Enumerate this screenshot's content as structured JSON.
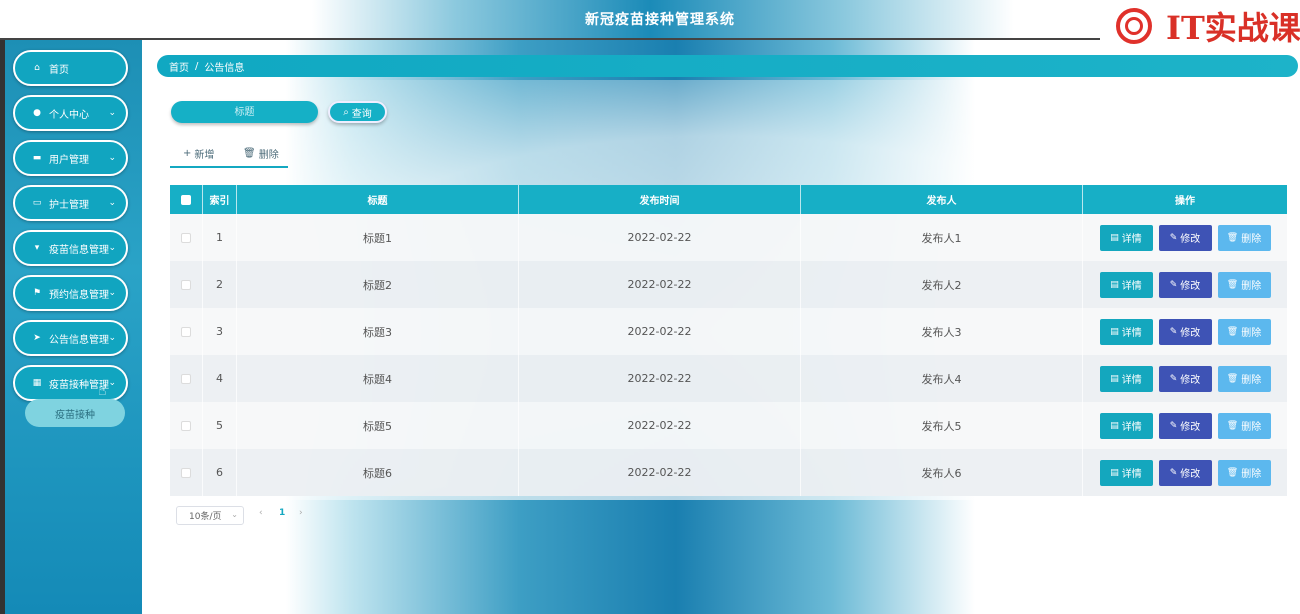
{
  "header": {
    "title": "新冠疫苗接种管理系统",
    "brand_text": "IT实战课"
  },
  "sidebar": {
    "items": [
      {
        "label": "首页",
        "icon": "home-icon",
        "has_children": false
      },
      {
        "label": "个人中心",
        "icon": "user-icon",
        "has_children": true
      },
      {
        "label": "用户管理",
        "icon": "monitor-icon",
        "has_children": true
      },
      {
        "label": "护士管理",
        "icon": "ticket-icon",
        "has_children": true
      },
      {
        "label": "疫苗信息管理",
        "icon": "cup-icon",
        "has_children": true
      },
      {
        "label": "预约信息管理",
        "icon": "flag-icon",
        "has_children": true
      },
      {
        "label": "公告信息管理",
        "icon": "send-icon",
        "has_children": true
      },
      {
        "label": "疫苗接种管理",
        "icon": "grid-icon",
        "has_children": true
      }
    ],
    "submenu": {
      "label": "疫苗接种"
    }
  },
  "breadcrumb": {
    "home": "首页",
    "separator": "/",
    "current": "公告信息"
  },
  "search": {
    "placeholder": "标题",
    "button_label": "查询"
  },
  "toolbar": {
    "add_label": "新增",
    "delete_label": "删除"
  },
  "table": {
    "columns": [
      "索引",
      "标题",
      "发布时间",
      "发布人",
      "操作"
    ],
    "rows": [
      {
        "index": "1",
        "title": "标题1",
        "time": "2022-02-22",
        "publisher": "发布人1"
      },
      {
        "index": "2",
        "title": "标题2",
        "time": "2022-02-22",
        "publisher": "发布人2"
      },
      {
        "index": "3",
        "title": "标题3",
        "time": "2022-02-22",
        "publisher": "发布人3"
      },
      {
        "index": "4",
        "title": "标题4",
        "time": "2022-02-22",
        "publisher": "发布人4"
      },
      {
        "index": "5",
        "title": "标题5",
        "time": "2022-02-22",
        "publisher": "发布人5"
      },
      {
        "index": "6",
        "title": "标题6",
        "time": "2022-02-22",
        "publisher": "发布人6"
      }
    ],
    "actions": {
      "detail": "详情",
      "edit": "修改",
      "delete": "删除"
    }
  },
  "pagination": {
    "page_size": "10条/页",
    "current_page": "1",
    "prev": "‹",
    "next": "›"
  },
  "colors": {
    "accent": "#17afc6",
    "edit_button": "#3e53b5",
    "delete_button": "#5cb8ee",
    "detail_button": "#14a7be"
  }
}
